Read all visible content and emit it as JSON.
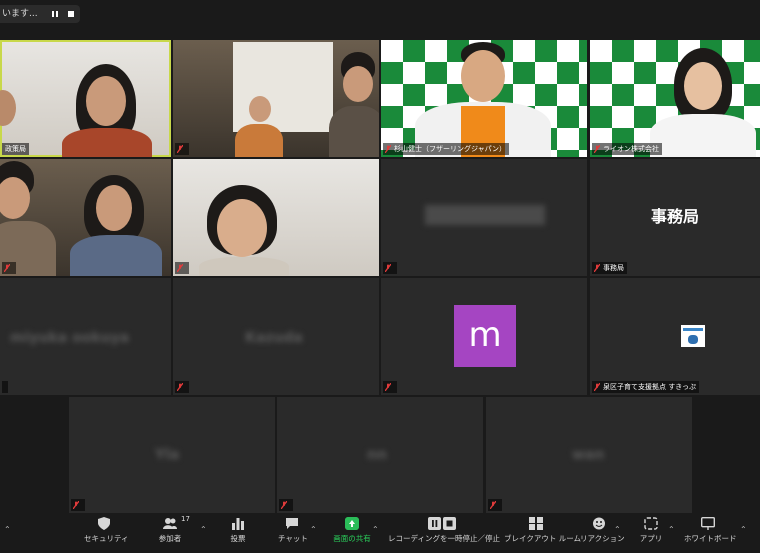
{
  "recording": {
    "status_text": "います..."
  },
  "tiles": [
    {
      "name": "政策局"
    },
    {
      "name": ""
    },
    {
      "name": "杉山健士（フザーリングジャパン）"
    },
    {
      "name": "ライオン株式会社"
    },
    {
      "name": ""
    },
    {
      "name": ""
    },
    {
      "name": ""
    },
    {
      "name": "事務局",
      "center_label": "事務局"
    },
    {
      "name": "",
      "blur_label": "miyuka ookuya"
    },
    {
      "name": "",
      "blur_label": "Kazuda"
    },
    {
      "name": "",
      "avatar_letter": "m"
    },
    {
      "name": "泉区子育て支援拠点 すきっぷ"
    },
    {
      "name": "",
      "blur_label": "Yla"
    },
    {
      "name": "",
      "blur_label": "nn"
    },
    {
      "name": "",
      "blur_label": "wan"
    }
  ],
  "toolbar": {
    "security": "セキュリティ",
    "participants": "参加者",
    "participants_count": "17",
    "polls": "投票",
    "chat": "チャット",
    "share": "画面の共有",
    "recording": "レコーディングを一時停止／停止",
    "breakout": "ブレイクアウト ルーム",
    "reactions": "リアクション",
    "apps": "アプリ",
    "whiteboard": "ホワイトボード"
  },
  "colors": {
    "active_speaker": "#c8d84a",
    "share": "#2bbd59",
    "avatar": "#a545c2",
    "mic_off": "#e23b3b"
  }
}
